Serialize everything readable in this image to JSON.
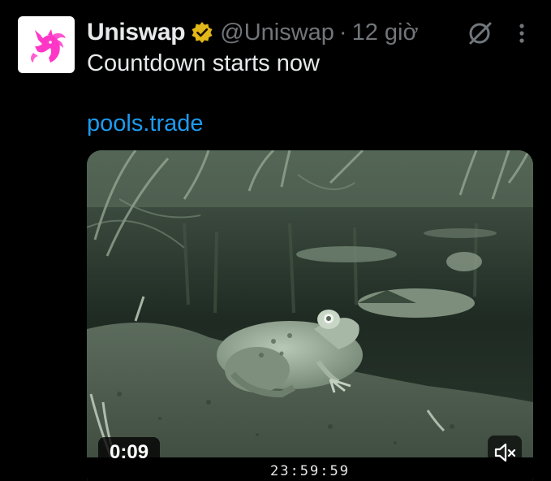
{
  "tweet": {
    "author_name": "Uniswap",
    "handle": "@Uniswap",
    "separator": "·",
    "time": "12 giờ",
    "text": "Countdown starts now",
    "link_text": "pools.trade",
    "verified_icon": "gold-verified-badge-icon",
    "avatar_icon": "unicorn-logo-icon"
  },
  "media": {
    "duration": "0:09",
    "timestamp": "23:59:59",
    "mute_icon": "speaker-muted-icon"
  },
  "colors": {
    "background": "#000000",
    "text": "#e7e9ea",
    "muted_text": "#71767b",
    "link": "#1d9bf0",
    "brand_pink": "#ff37c7",
    "verified_gold": "#e2b719"
  }
}
